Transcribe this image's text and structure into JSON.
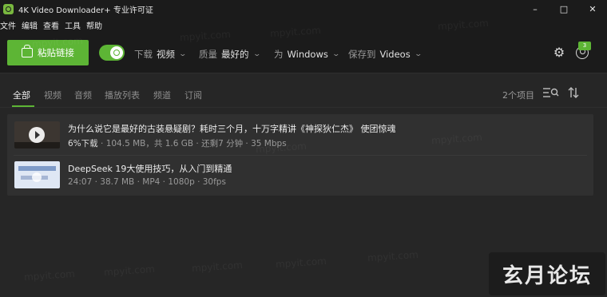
{
  "window": {
    "title": "4K Video Downloader+ 专业许可证",
    "controls": [
      "–",
      "□",
      "✕"
    ]
  },
  "menu": [
    "文件",
    "编辑",
    "查看",
    "工具",
    "帮助"
  ],
  "toolbar": {
    "paste_label": "粘贴链接",
    "smart_mode_on": true,
    "download_label": "下载",
    "download_value": "视频",
    "quality_label": "质量",
    "quality_value": "最好的",
    "for_label": "为",
    "for_value": "Windows",
    "save_label": "保存到",
    "save_value": "Videos",
    "notification_count": "3",
    "icons": {
      "settings": "gear-icon",
      "account": "account-icon"
    }
  },
  "tabs": [
    "全部",
    "视频",
    "音频",
    "播放列表",
    "频道",
    "订阅"
  ],
  "active_tab": "全部",
  "item_count": "2个项目",
  "items": [
    {
      "title": "为什么说它是最好的古装悬疑剧？耗时三个月，十万字精讲《神探狄仁杰》 使团惊魂",
      "progress": "6%下载",
      "details": "· 104.5 MB，共 1.6 GB · 还剩7 分钟 · 35 Mbps"
    },
    {
      "title": "DeepSeek 19大使用技巧，从入门到精通",
      "progress": "",
      "details": "24:07 · 38.7 MB · MP4 · 1080p · 30fps"
    }
  ],
  "watermark": "mpyit.com",
  "forum_badge": "玄月论坛",
  "colors": {
    "accent": "#5db535",
    "background": "#262626",
    "toolbar": "#1b1b1b"
  }
}
